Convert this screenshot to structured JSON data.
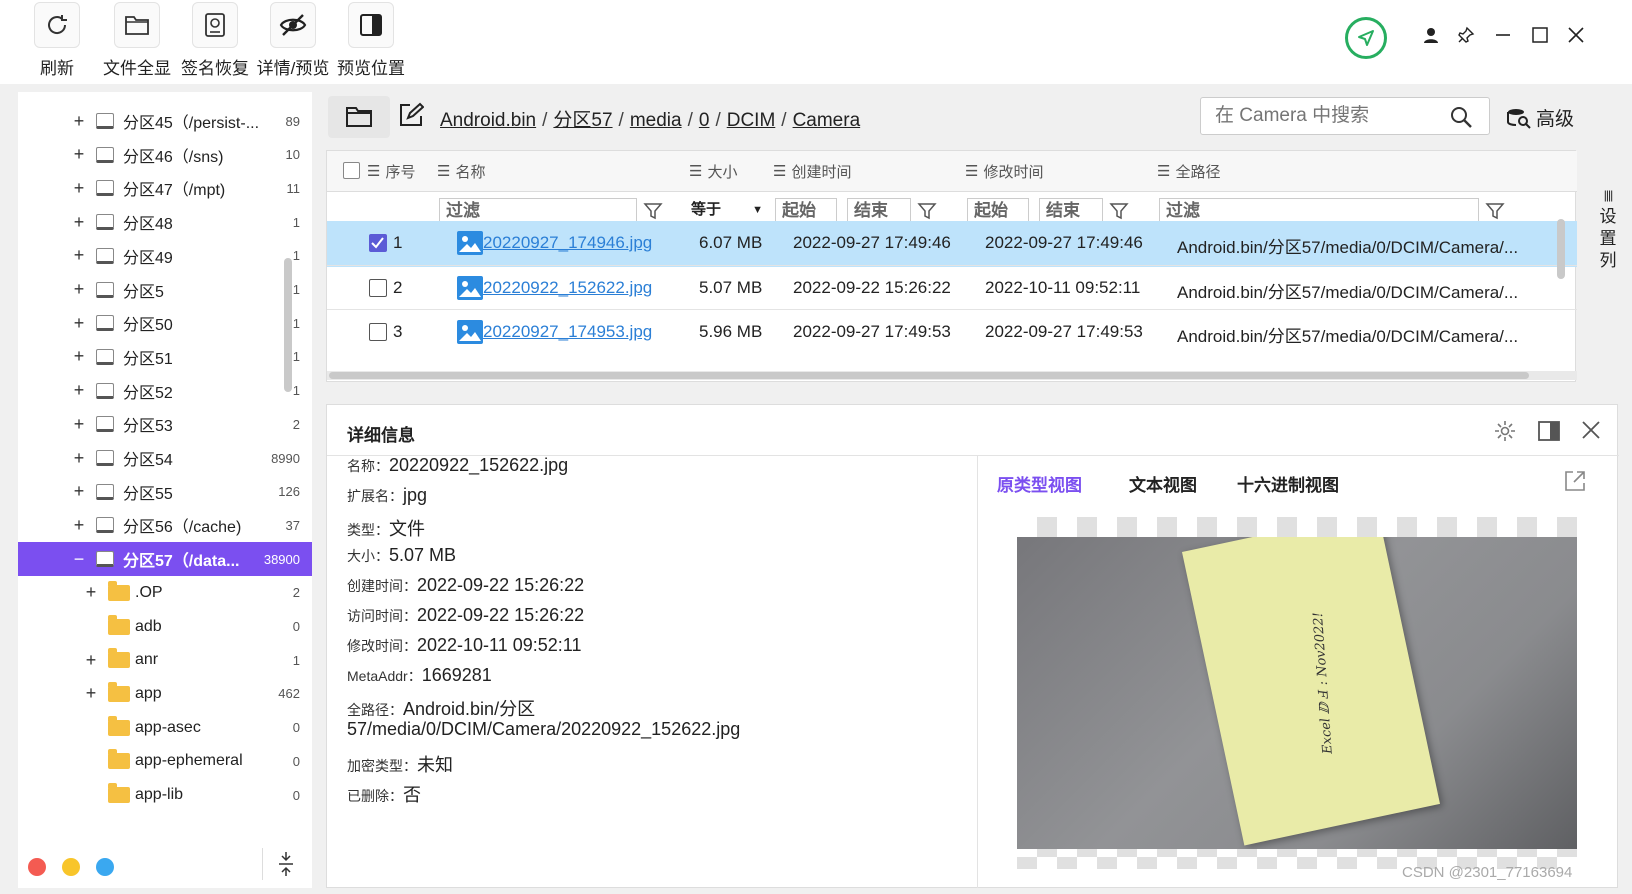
{
  "toolbar": {
    "refresh": "刷新",
    "show_all": "文件全显",
    "sig_recover": "签名恢复",
    "detail_preview": "详情/预览",
    "preview_pos": "预览位置"
  },
  "tree": {
    "rows": [
      {
        "label": "分区45（/persist-...",
        "count": "89"
      },
      {
        "label": "分区46（/sns)",
        "count": "10"
      },
      {
        "label": "分区47（/mpt)",
        "count": "11"
      },
      {
        "label": "分区48",
        "count": "1"
      },
      {
        "label": "分区49",
        "count": "1"
      },
      {
        "label": "分区5",
        "count": "1"
      },
      {
        "label": "分区50",
        "count": "1"
      },
      {
        "label": "分区51",
        "count": "1"
      },
      {
        "label": "分区52",
        "count": "1"
      },
      {
        "label": "分区53",
        "count": "2"
      },
      {
        "label": "分区54",
        "count": "8990"
      },
      {
        "label": "分区55",
        "count": "126"
      },
      {
        "label": "分区56（/cache)",
        "count": "37"
      },
      {
        "label": "分区57（/data...",
        "count": "38900"
      },
      {
        "label": ".OP",
        "count": "2"
      },
      {
        "label": "adb",
        "count": "0"
      },
      {
        "label": "anr",
        "count": "1"
      },
      {
        "label": "app",
        "count": "462"
      },
      {
        "label": "app-asec",
        "count": "0"
      },
      {
        "label": "app-ephemeral",
        "count": "0"
      },
      {
        "label": "app-lib",
        "count": "0"
      }
    ]
  },
  "breadcrumb": [
    "Android.bin",
    "分区57",
    "media",
    "0",
    "DCIM",
    "Camera"
  ],
  "search": {
    "placeholder": "在 Camera 中搜索"
  },
  "advanced": "高级",
  "table": {
    "headers": {
      "index": "序号",
      "name": "名称",
      "size": "大小",
      "created": "创建时间",
      "modified": "修改时间",
      "path": "全路径"
    },
    "filters": {
      "name": "过滤",
      "size": "等于",
      "start": "起始",
      "end": "结束",
      "path": "过滤"
    },
    "rows": [
      {
        "index": "1",
        "name": "20220927_174946.jpg",
        "size": "6.07 MB",
        "created": "2022-09-27 17:49:46",
        "modified": "2022-09-27 17:49:46",
        "path": "Android.bin/分区57/media/0/DCIM/Camera/...",
        "checked": true
      },
      {
        "index": "2",
        "name": "20220922_152622.jpg",
        "size": "5.07 MB",
        "created": "2022-09-22 15:26:22",
        "modified": "2022-10-11 09:52:11",
        "path": "Android.bin/分区57/media/0/DCIM/Camera/...",
        "checked": false
      },
      {
        "index": "3",
        "name": "20220927_174953.jpg",
        "size": "5.96 MB",
        "created": "2022-09-27 17:49:53",
        "modified": "2022-09-27 17:49:53",
        "path": "Android.bin/分区57/media/0/DCIM/Camera/...",
        "checked": false
      }
    ],
    "set_columns": [
      "设",
      "置",
      "列"
    ]
  },
  "detail": {
    "title": "详细信息",
    "props": [
      {
        "k": "名称：",
        "v": "20220922_152622.jpg"
      },
      {
        "k": "扩展名：",
        "v": "jpg"
      },
      {
        "k": "类型：",
        "v": "文件"
      },
      {
        "k": "大小：",
        "v": "5.07 MB"
      },
      {
        "k": "创建时间：",
        "v": "2022-09-22 15:26:22"
      },
      {
        "k": "访问时间：",
        "v": "2022-09-22 15:26:22"
      },
      {
        "k": "修改时间：",
        "v": "2022-10-11 09:52:11"
      },
      {
        "k": "MetaAddr：",
        "v": "1669281"
      },
      {
        "k": "全路径：",
        "v": "Android.bin/分区"
      },
      {
        "k": "",
        "v": "57/media/0/DCIM/Camera/20220922_152622.jpg"
      },
      {
        "k": "加密类型：",
        "v": "未知"
      },
      {
        "k": "已删除：",
        "v": "否"
      }
    ],
    "tabs": [
      "原类型视图",
      "文本视图",
      "十六进制视图"
    ],
    "photo_text": "Excel ⅅ Ⅎ : Nov2022!"
  },
  "colors": {
    "accent": "#7b4ff0",
    "link": "#2b7fd6",
    "selected_row": "#bee3fb",
    "nav_green": "#27ae60"
  },
  "watermark": "CSDN @2301_77163694"
}
